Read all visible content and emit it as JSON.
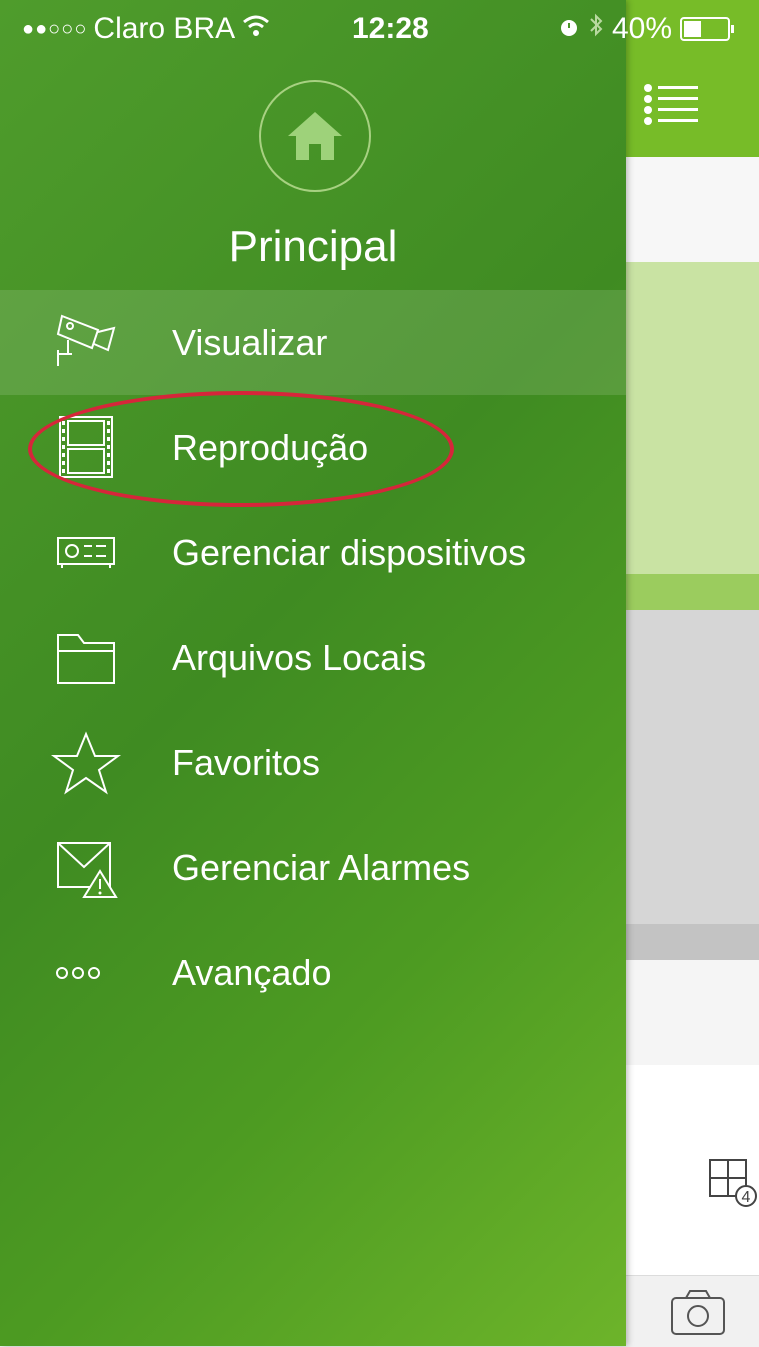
{
  "status_bar": {
    "carrier": "Claro BRA",
    "time": "12:28",
    "battery": "40%"
  },
  "drawer": {
    "title": "Principal",
    "items": [
      {
        "label": "Visualizar",
        "icon": "camera-icon"
      },
      {
        "label": "Reprodução",
        "icon": "filmstrip-icon"
      },
      {
        "label": "Gerenciar dispositivos",
        "icon": "device-icon"
      },
      {
        "label": "Arquivos Locais",
        "icon": "folder-icon"
      },
      {
        "label": "Favoritos",
        "icon": "star-icon"
      },
      {
        "label": "Gerenciar Alarmes",
        "icon": "alarm-mail-icon"
      },
      {
        "label": "Avançado",
        "icon": "more-icon"
      }
    ]
  },
  "background_app": {
    "grid_badge": "4"
  },
  "colors": {
    "drawer_green": "#4a9726",
    "accent_green": "#77bc28",
    "highlight_red": "#d6263a"
  }
}
